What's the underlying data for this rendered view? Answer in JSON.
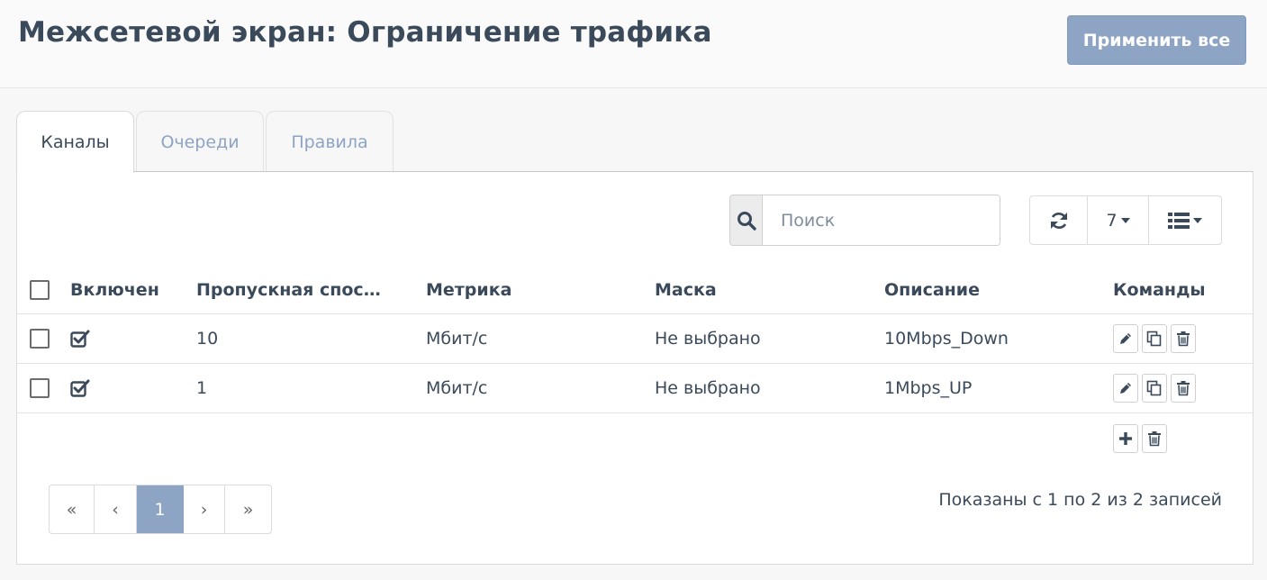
{
  "header": {
    "title": "Межсетевой экран: Ограничение трафика",
    "apply_label": "Применить все"
  },
  "tabs": [
    {
      "label": "Каналы",
      "active": true
    },
    {
      "label": "Очереди",
      "active": false
    },
    {
      "label": "Правила",
      "active": false
    }
  ],
  "toolbar": {
    "search_placeholder": "Поиск",
    "page_size": "7",
    "icons": {
      "search": "search-icon",
      "refresh": "refresh-icon",
      "columns": "list-columns-icon"
    }
  },
  "table": {
    "columns": [
      "Включен",
      "Пропускная спос…",
      "Метрика",
      "Маска",
      "Описание",
      "Команды"
    ],
    "rows": [
      {
        "enabled": true,
        "bandwidth": "10",
        "metric": "Мбит/с",
        "mask": "Не выбрано",
        "description": "10Mbps_Down"
      },
      {
        "enabled": true,
        "bandwidth": "1",
        "metric": "Мбит/с",
        "mask": "Не выбрано",
        "description": "1Mbps_UP"
      }
    ]
  },
  "pagination": {
    "first": "«",
    "prev": "‹",
    "current": "1",
    "next": "›",
    "last": "»",
    "info": "Показаны с 1 по 2 из 2 записей"
  },
  "colors": {
    "accent": "#8ea4c4",
    "text": "#3b4a5a",
    "border": "#dcdcdc"
  }
}
